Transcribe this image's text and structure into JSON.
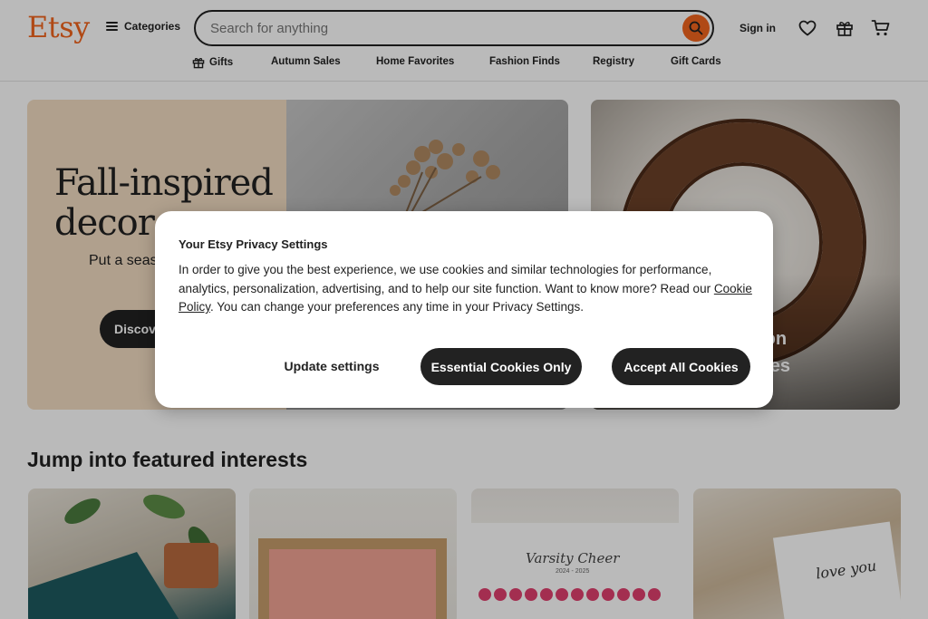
{
  "header": {
    "logo": "Etsy",
    "categories_label": "Categories",
    "search_placeholder": "Search for anything",
    "signin_label": "Sign in",
    "icons": [
      "search-icon",
      "heart-icon",
      "gift-icon",
      "cart-icon"
    ]
  },
  "subnav": {
    "items": [
      "Gifts",
      "Autumn Sales",
      "Home Favorites",
      "Fashion Finds",
      "Registry",
      "Gift Cards"
    ]
  },
  "hero": {
    "left_title": "Fall-inspired decor",
    "left_subtitle": "Put a seasonal spin on your",
    "left_button": "Discover more",
    "right_caption_line1": "...on",
    "right_caption_line2": "...ves"
  },
  "featured": {
    "title": "Jump into featured interests",
    "card3_text": "Varsity Cheer",
    "card3_date": "2024 - 2025",
    "card4_text": "love you"
  },
  "modal": {
    "title": "Your Etsy Privacy Settings",
    "body_before_link": "In order to give you the best experience, we use cookies and similar technologies for performance, analytics, personalization, advertising, and to help our site function. Want to know more? Read our ",
    "link_text": "Cookie Policy",
    "body_after_link": ". You can change your preferences any time in your Privacy Settings.",
    "update_button": "Update settings",
    "essential_button": "Essential Cookies Only",
    "accept_button": "Accept All Cookies"
  },
  "colors": {
    "brand": "#f1641e",
    "dark_button": "#222222"
  }
}
